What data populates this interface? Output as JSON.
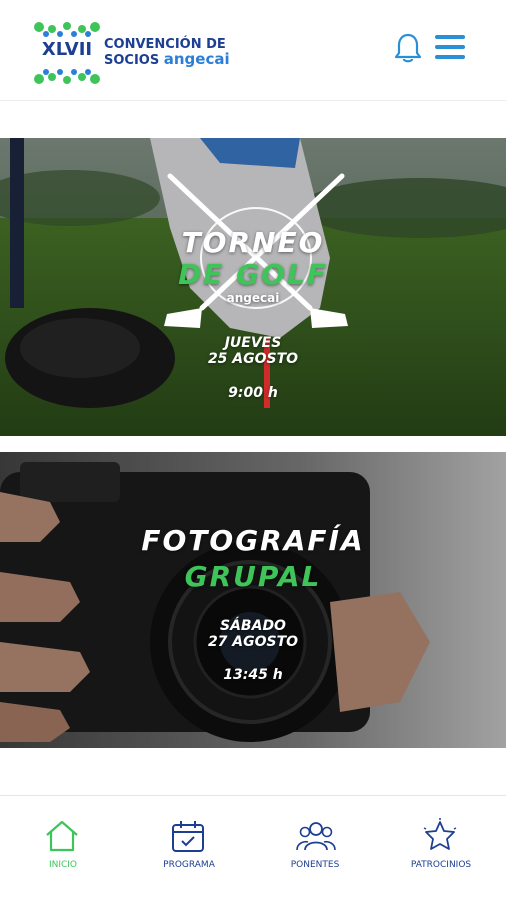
{
  "header": {
    "logo_roman": "XLVII",
    "logo_line1": "CONVENCIÓN DE",
    "logo_line2": "SOCIOS",
    "logo_brand": "angecai",
    "notifications_icon": "bell-icon",
    "menu_icon": "hamburger-menu-icon"
  },
  "events": [
    {
      "title_line1": "TORNEO",
      "title_line2": "DE GOLF",
      "brand": "angecai",
      "day": "JUEVES",
      "date": "25 AGOSTO",
      "time": "9:00 h"
    },
    {
      "title_line1": "FOTOGRAFÍA",
      "title_line2": "GRUPAL",
      "day": "SÁBADO",
      "date": "27 AGOSTO",
      "time": "13:45 h"
    }
  ],
  "nav": {
    "items": [
      {
        "label": "INICIO",
        "icon": "home-icon",
        "active": true
      },
      {
        "label": "PROGRAMA",
        "icon": "calendar-icon",
        "active": false
      },
      {
        "label": "PONENTES",
        "icon": "people-icon",
        "active": false
      },
      {
        "label": "PATROCINIOS",
        "icon": "star-icon",
        "active": false
      }
    ]
  },
  "colors": {
    "brand_blue": "#1c3f93",
    "accent_green": "#3fc45a",
    "icon_blue": "#2b8fd6"
  }
}
